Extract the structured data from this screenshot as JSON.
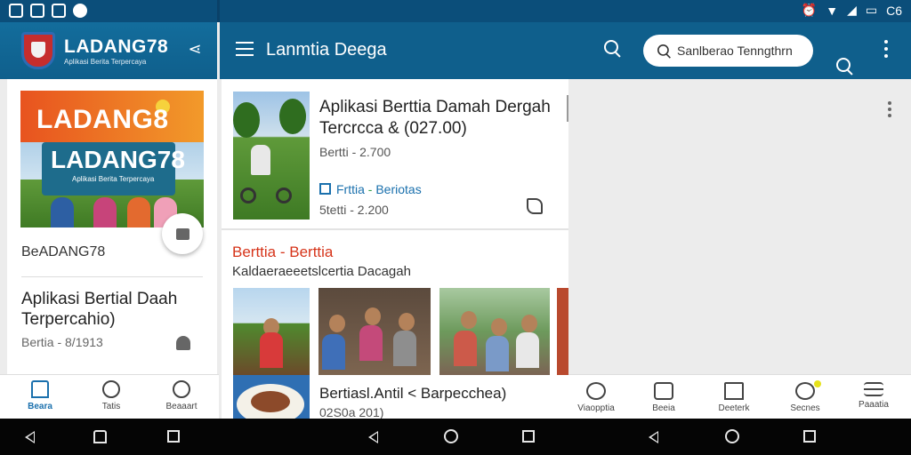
{
  "status_bar": {
    "right_text": "C6",
    "icons": [
      "sd-card-icon",
      "image-icon",
      "message-icon",
      "record-icon",
      "alarm-icon",
      "wifi-icon",
      "signal-icon",
      "battery-icon"
    ]
  },
  "left_header": {
    "logo_title": "LADANG78",
    "logo_subtitle": "Aplikasi Berita Terpercaya",
    "share_icon": "share-icon"
  },
  "main_header": {
    "title": "Lanmtia Deega",
    "search_placeholder": "Sanlberao Tenngthrn"
  },
  "left_panel": {
    "hero_text_1": "LADANG8",
    "hero_text_2": "LADANG78",
    "hero_text_3": "Aplikasi Berita Terpercaya",
    "brand_label": "BeADANG78",
    "article_title": "Aplikasi Bertial Daah Terpercahio)",
    "article_meta": "Bertia - 8/1913"
  },
  "left_bottom_nav": {
    "items": [
      {
        "label": "Beara",
        "icon": "home-icon",
        "active": true
      },
      {
        "label": "Tatis",
        "icon": "info-icon",
        "active": false
      },
      {
        "label": "Beaaart",
        "icon": "location-icon",
        "active": false
      }
    ]
  },
  "feed": {
    "card1": {
      "title": "Aplikasi Berttia Damah Dergah Tercrcca & (027.00)",
      "meta": "Bertti - 2.700",
      "tag_label": "Frttia",
      "tag_separator": " - ",
      "tag_value": "Beriotas",
      "meta2": "5tetti - 2.200"
    },
    "section_title": "Berttia - Berttia",
    "section_subtitle": "Kaldaeraeeetslcertia Dacagah",
    "card3": {
      "title": "Bertiasl.Antil < Barpecchea)",
      "meta": "02S0a 201)"
    }
  },
  "right_bottom_nav": {
    "items": [
      {
        "label": "Viaopptia",
        "icon": "globe-icon"
      },
      {
        "label": "Beeia",
        "icon": "newspaper-icon"
      },
      {
        "label": "Deeterk",
        "icon": "house-icon"
      },
      {
        "label": "Secnes",
        "icon": "profile-icon"
      },
      {
        "label": "Paaatia",
        "icon": "menu-icon"
      }
    ]
  },
  "colors": {
    "appbar": "#0f5f8c",
    "statusbar": "#0b4e7a",
    "accent": "#1a70ad",
    "section_red": "#d6341a"
  }
}
